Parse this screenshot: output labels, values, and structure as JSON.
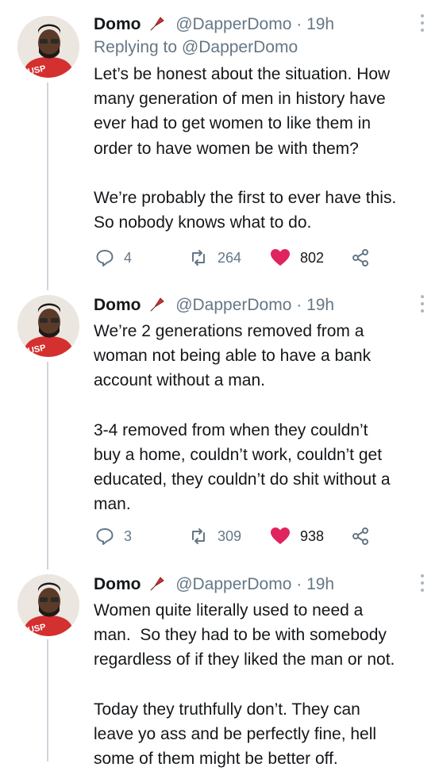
{
  "tweets": [
    {
      "name": "Domo",
      "handle": "@DapperDomo",
      "time": "· 19h",
      "replying_label": "Replying to",
      "replying_handle": "@DapperDomo",
      "text": "Let’s be honest about the situation. How\nmany generation of men in history have\never had to get women to like them in\norder to have women be with them?\n\nWe’re probably the first to ever have this.\nSo nobody knows what to do.",
      "replies": "4",
      "retweets": "264",
      "likes": "802"
    },
    {
      "name": "Domo",
      "handle": "@DapperDomo",
      "time": "· 19h",
      "text": "We’re 2 generations removed from a\nwoman not being able to have a bank\naccount without a man.\n\n3-4 removed from when they couldn’t\nbuy a home, couldn’t work, couldn’t get\neducated, they couldn’t do shit without a\nman.",
      "replies": "3",
      "retweets": "309",
      "likes": "938"
    },
    {
      "name": "Domo",
      "handle": "@DapperDomo",
      "time": "· 19h",
      "text": "Women quite literally used to need a\nman.  So they had to be with somebody\nregardless of if they liked the man or not.\n\nToday they truthfully don’t. They can\nleave yo ass and be perfectly fine, hell\nsome of them might be better off."
    }
  ],
  "avatar_shirt_text": "USP",
  "colors": {
    "like": "#e0245e",
    "muted": "#657786",
    "shirt": "#d4302f"
  }
}
